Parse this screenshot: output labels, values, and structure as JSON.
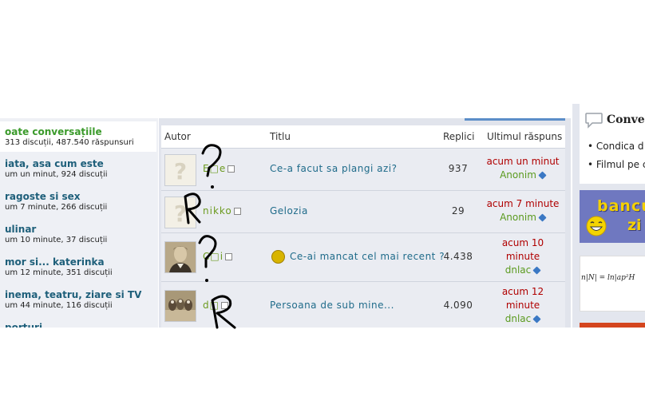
{
  "sidebar": {
    "categories": [
      {
        "title": "oate conversațiile",
        "meta": "313 discuții,  487.540 răspunsuri",
        "active": true
      },
      {
        "title": "iata, asa cum este",
        "meta": "um un minut,  924 discuții"
      },
      {
        "title": "ragoste si sex",
        "meta": "um 7 minute,  266 discuții"
      },
      {
        "title": "ulinar",
        "meta": "um 10 minute,  37 discuții"
      },
      {
        "title": "mor si... katerinka",
        "meta": "um 12 minute,  351 discuții"
      },
      {
        "title": "inema, teatru, ziare si TV",
        "meta": "um 44 minute,  116 discuții"
      },
      {
        "title": "porturi",
        "meta": ""
      }
    ]
  },
  "table": {
    "headers": {
      "author": "Autor",
      "title": "Titlu",
      "replies": "Replici",
      "last": "Ultimul răspuns"
    },
    "rows": [
      {
        "author": "E□e",
        "title": "Ce-a facut sa plangi azi?",
        "replies": "937",
        "last_time": "acum un minut",
        "last_user": "Anonim",
        "avatar": "question-avatar"
      },
      {
        "author": "nikko",
        "title": "Gelozia",
        "replies": "29",
        "last_time": "acum 7 minute",
        "last_user": "Anonim",
        "avatar": "question-avatar"
      },
      {
        "author": "C□i",
        "title": "Ce-ai mancat cel mai recent ?",
        "replies": "4.438",
        "last_time": "acum 10 minute",
        "last_user": "dnlac",
        "avatar": "photo-avatar",
        "poll": true
      },
      {
        "author": "d□",
        "title": "Persoana de sub mine...",
        "replies": "4.090",
        "last_time": "acum 12 minute",
        "last_user": "dnlac",
        "avatar": "birds-avatar"
      }
    ]
  },
  "right": {
    "heading": "Conve",
    "items": [
      "• Condica d",
      "• Filmul pe c"
    ],
    "banner_line1": "bancu",
    "banner_line2": "zi",
    "formula": "n|N| = ln|ap²H"
  },
  "annotations": [
    "?",
    "R",
    "?",
    "R"
  ],
  "colors": {
    "link_blue": "#1f6b8a",
    "author_green": "#6b9a1e",
    "time_red": "#b00000",
    "active_green": "#3a9a2a"
  }
}
